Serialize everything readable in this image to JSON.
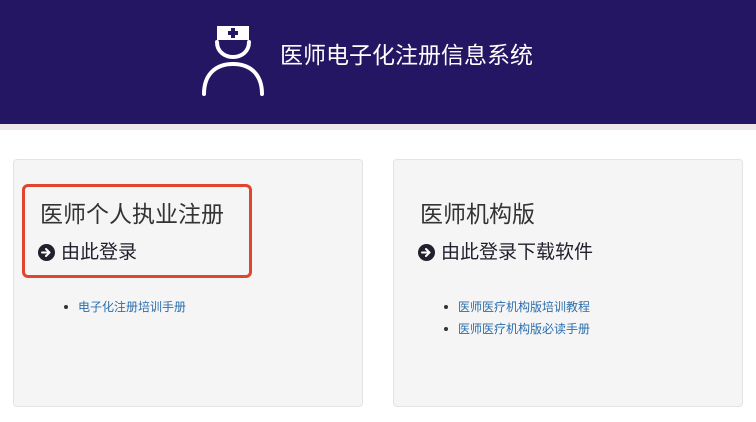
{
  "header": {
    "title": "医师电子化注册信息系统",
    "logo_icon": "doctor-nurse-icon",
    "background_color": "#241662"
  },
  "panels": {
    "individual": {
      "title": "医师个人执业注册",
      "link_label": "由此登录",
      "link_icon": "circle-arrow-right-icon",
      "highlight_color": "#e2452f",
      "docs": [
        "电子化注册培训手册"
      ]
    },
    "institution": {
      "title": "医师机构版",
      "link_label": "由此登录下载软件",
      "link_icon": "circle-arrow-right-icon",
      "docs": [
        "医师医疗机构版培训教程",
        "医师医疗机构版必读手册"
      ]
    }
  },
  "colors": {
    "link": "#2a6ead",
    "panel_bg": "#f5f5f5"
  }
}
